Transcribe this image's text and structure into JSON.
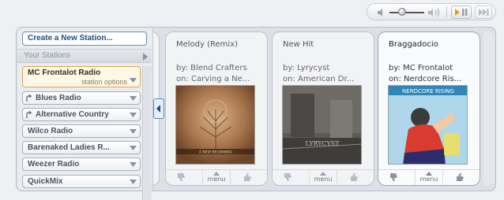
{
  "player": {
    "volume_level": 0.45,
    "play_pause_label": "play/pause",
    "skip_label": "skip"
  },
  "sidebar": {
    "create_station": "Create a New Station...",
    "your_stations": "Your Stations",
    "active_station": {
      "name": "MC Frontalot Radio",
      "options": "station options"
    },
    "stations": [
      {
        "name": "Blues Radio",
        "shared": true
      },
      {
        "name": "Alternative Country",
        "shared": true
      },
      {
        "name": "Wilco Radio",
        "shared": false
      },
      {
        "name": "Barenaked Ladies R...",
        "shared": false
      },
      {
        "name": "Weezer Radio",
        "shared": false
      }
    ],
    "quickmix": "QuickMix"
  },
  "songs": [
    {
      "title": "Melody (Remix)",
      "by": "by: Blend Crafters",
      "on": "on: Carving a Ne...",
      "menu": "menu",
      "current": false
    },
    {
      "title": "New Hit",
      "by": "by: Lyrycyst",
      "on": "on: American Dr...",
      "menu": "menu",
      "current": false
    },
    {
      "title": "Braggadocio",
      "by": "by: MC Frontalot",
      "on": "on: Nerdcore Ris...",
      "menu": "menu",
      "current": true
    }
  ],
  "album_art_text": {
    "song_1": "A NEW BEGINNING",
    "song_2": "LYRYCYST",
    "song_3": "NERDCORE RISING"
  },
  "colors": {
    "accent_blue": "#1f4e86",
    "active_border": "#e3a34a",
    "play_orange": "#e8a200"
  }
}
